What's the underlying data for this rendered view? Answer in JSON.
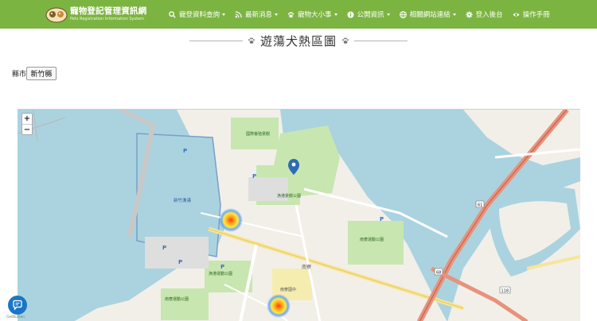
{
  "app": {
    "logo_title": "寵物登記管理資訊網",
    "logo_subtitle": "Pets Registration Information System"
  },
  "nav": [
    {
      "label": "寵登資料查詢",
      "icon": "search-icon",
      "dropdown": true
    },
    {
      "label": "最新消息",
      "icon": "rss-icon",
      "dropdown": true
    },
    {
      "label": "寵物大小事",
      "icon": "paw-icon",
      "dropdown": true
    },
    {
      "label": "公開資訊",
      "icon": "info-icon",
      "dropdown": true
    },
    {
      "label": "相關網站連結",
      "icon": "globe-icon",
      "dropdown": true
    },
    {
      "label": "登入後台",
      "icon": "gear-icon",
      "dropdown": false
    },
    {
      "label": "操作手冊",
      "icon": "eye-icon",
      "dropdown": false
    }
  ],
  "page": {
    "title": "遊蕩犬熱區圖"
  },
  "filter": {
    "county_label": "縣市",
    "county_value": "新竹縣"
  },
  "map": {
    "zoom_in": "+",
    "zoom_out": "−",
    "labels": {
      "harbor": "新竹漁港",
      "visitor_center": "國際養殖景觀",
      "park1": "漁港景觀公園",
      "park2": "漁港運動公園",
      "park3": "南寮運動公園",
      "park4": "南寮運動公園",
      "school": "南寮國中",
      "district": "南寮",
      "road_61": "61",
      "road_68": "68",
      "road_118": "118"
    }
  },
  "widget": {
    "caption": "GetButton"
  },
  "colors": {
    "navbar": "#7cb442",
    "sea": "#aad3df",
    "land": "#f2efe9",
    "park": "#c8e6b0",
    "highway": "#e8927c",
    "heat_center": "#ff3b1f",
    "heat_mid": "#ffd42a",
    "heat_outer": "#4e9cf5"
  }
}
